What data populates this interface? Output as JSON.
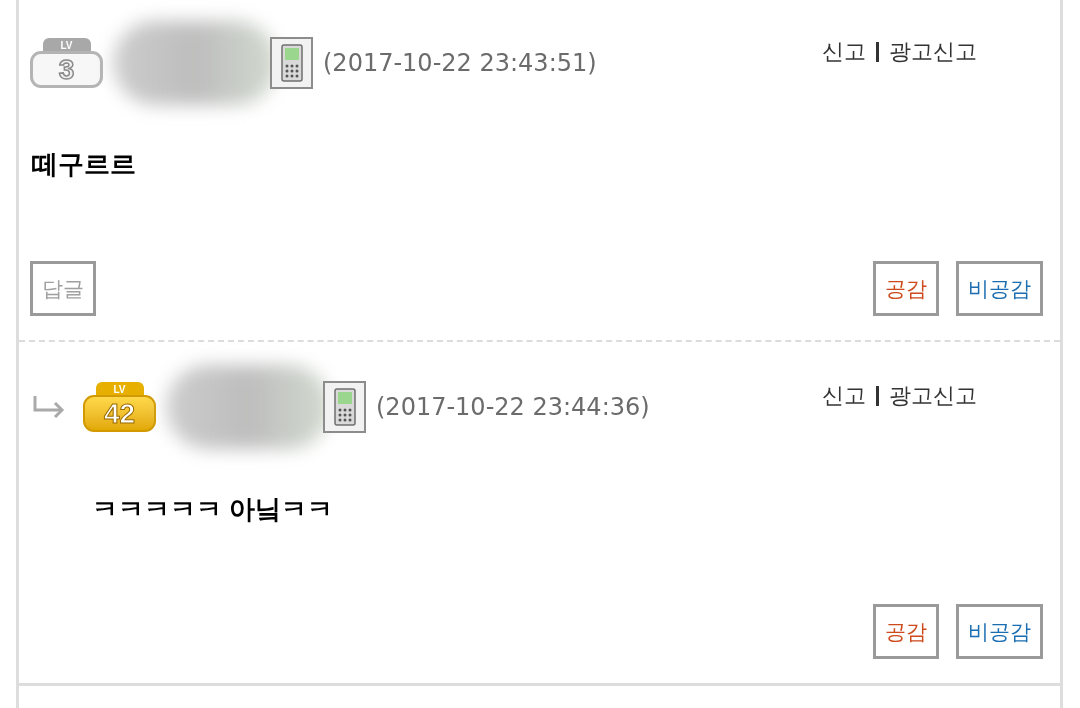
{
  "comments": [
    {
      "badge": {
        "kind": "silver",
        "label": "LV",
        "number": "3"
      },
      "mobile": true,
      "timestamp": "(2017-10-22 23:43:51)",
      "report_links": [
        "신고",
        "광고신고"
      ],
      "body": "떼구르르",
      "reply_button": "답글",
      "vote_buttons": [
        {
          "kind": "agree",
          "label": "공감"
        },
        {
          "kind": "disagree",
          "label": "비공감"
        }
      ],
      "children": [
        {
          "badge": {
            "kind": "gold",
            "label": "LV",
            "number": "42"
          },
          "mobile": true,
          "timestamp": "(2017-10-22 23:44:36)",
          "report_links": [
            "신고",
            "광고신고"
          ],
          "body": "ㅋㅋㅋㅋㅋ 아닠ㅋㅋ",
          "vote_buttons": [
            {
              "kind": "agree",
              "label": "공감"
            },
            {
              "kind": "disagree",
              "label": "비공감"
            }
          ]
        }
      ]
    }
  ]
}
